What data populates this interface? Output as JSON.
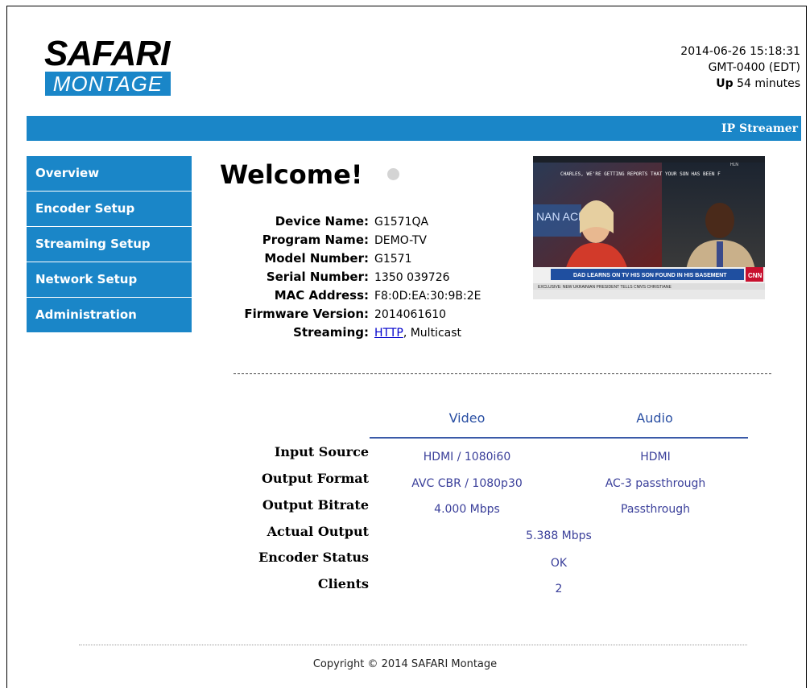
{
  "logo": {
    "top": "SAFARI",
    "bottom": "MONTAGE"
  },
  "header": {
    "datetime": "2014-06-26 15:18:31",
    "timezone": "GMT-0400 (EDT)",
    "up_label": "Up",
    "up_value": "54 minutes",
    "section_title": "IP Streamer"
  },
  "sidebar": {
    "items": [
      {
        "label": "Overview"
      },
      {
        "label": "Encoder Setup"
      },
      {
        "label": "Streaming Setup"
      },
      {
        "label": "Network Setup"
      },
      {
        "label": "Administration"
      }
    ]
  },
  "main": {
    "welcome": "Welcome!",
    "details": [
      {
        "label": "Device Name:",
        "value": "G1571QA"
      },
      {
        "label": "Program Name:",
        "value": "DEMO-TV"
      },
      {
        "label": "Model Number:",
        "value": "G1571"
      },
      {
        "label": "Serial Number:",
        "value": "1350 039726"
      },
      {
        "label": "MAC Address:",
        "value": "F8:0D:EA:30:9B:2E"
      },
      {
        "label": "Firmware Version:",
        "value": "2014061610"
      }
    ],
    "streaming": {
      "label": "Streaming:",
      "link": "HTTP",
      "rest": ", Multicast"
    },
    "preview": {
      "caption_top": "CHARLES, WE'RE GETTING REPORTS THAT YOUR SON HAS BEEN F",
      "headline": "DAD LEARNS ON TV HIS SON FOUND IN HIS BASEMENT",
      "ticker": "EXCLUSIVE: NEW UKRAINIAN PRESIDENT TELLS CNN'S CHRISTIANE",
      "network": "CNN",
      "show": "NAN  ACE",
      "corner": "HLN"
    }
  },
  "stats": {
    "col_video": "Video",
    "col_audio": "Audio",
    "rows": {
      "input_source": {
        "label": "Input Source",
        "video": "HDMI / 1080i60",
        "audio": "HDMI"
      },
      "output_format": {
        "label": "Output Format",
        "video": "AVC CBR / 1080p30",
        "audio": "AC-3 passthrough"
      },
      "output_bitrate": {
        "label": "Output Bitrate",
        "video": "4.000 Mbps",
        "audio": "Passthrough"
      },
      "actual_output": {
        "label": "Actual Output",
        "value": "5.388 Mbps"
      },
      "encoder_status": {
        "label": "Encoder Status",
        "value": "OK"
      },
      "clients": {
        "label": "Clients",
        "value": "2"
      }
    }
  },
  "footer": {
    "copyright": "Copyright © 2014 SAFARI Montage"
  },
  "colors": {
    "brand_blue": "#1a86c8",
    "stat_text": "#3a3f9a"
  }
}
